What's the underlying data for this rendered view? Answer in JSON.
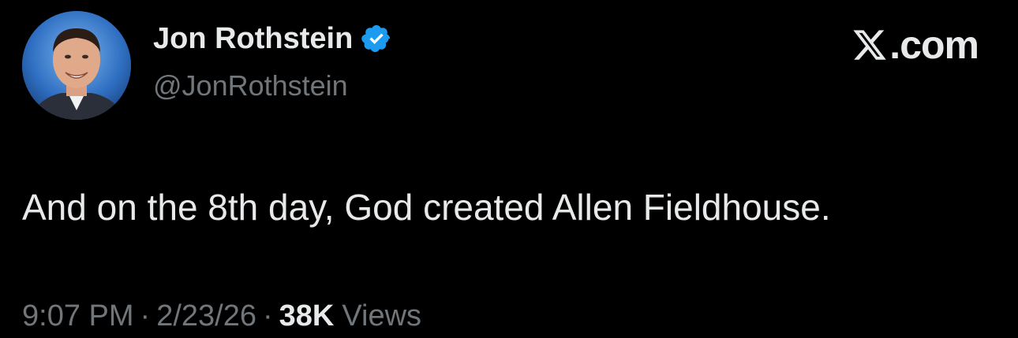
{
  "author": {
    "display_name": "Jon Rothstein",
    "handle": "@JonRothstein",
    "verified": true
  },
  "brand": {
    "text": "com",
    "dot": "."
  },
  "tweet": {
    "text": "And on the 8th day, God created Allen Fieldhouse."
  },
  "meta": {
    "time": "9:07 PM",
    "separator": "·",
    "date": "2/23/26",
    "views_count": "38K",
    "views_label": "Views"
  },
  "icons": {
    "verified": "verified-badge-icon",
    "brand_logo": "x-logo-icon"
  },
  "colors": {
    "background": "#000000",
    "primary_text": "#e7e9ea",
    "secondary_text": "#71767b",
    "verified_blue": "#1d9bf0"
  }
}
